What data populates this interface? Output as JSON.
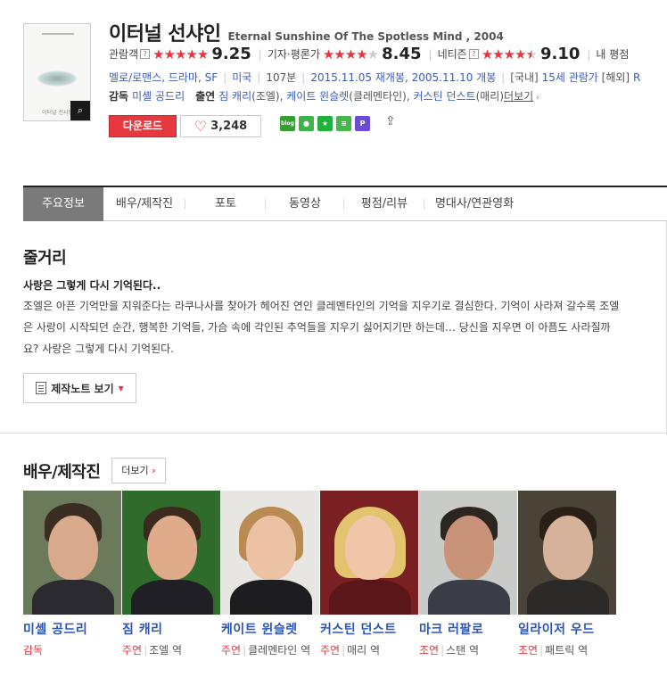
{
  "movie": {
    "title_ko": "이터널 선샤인",
    "title_en": "Eternal Sunshine Of The Spotless Mind , 2004",
    "poster_text": "이터널 선샤인"
  },
  "ratings": [
    {
      "label": "관람객",
      "score": "9.25",
      "stars_full": 5,
      "stars_half": false
    },
    {
      "label": "기자·평론가",
      "score": "8.45",
      "stars_full": 4,
      "stars_half": false
    },
    {
      "label": "네티즌",
      "score": "9.10",
      "stars_full": 4,
      "stars_half": true
    },
    {
      "label": "내 평점",
      "score": "",
      "stars_full": 0,
      "stars_half": false
    }
  ],
  "info": {
    "genres": "멜로/로맨스, 드라마, SF",
    "country": "미국",
    "runtime": "107분",
    "release_re": "2015.11.05 재개봉",
    "release_orig": "2005.11.10 개봉",
    "rating_kr_label": "[국내]",
    "rating_kr": "15세 관람가",
    "rating_os_label": "[해외]",
    "rating_os": "R"
  },
  "credits": {
    "director_label": "감독",
    "director": "미셸 공드리",
    "cast_label": "출연",
    "cast1": "짐 캐리",
    "cast1_role": "(조엘)",
    "cast2": "케이트 윈슬렛",
    "cast2_role": "(클레멘타인)",
    "cast3": "커스틴 던스트",
    "cast3_role": "(매리)",
    "more": "더보기"
  },
  "actions": {
    "download": "다운로드",
    "likes": "3,248"
  },
  "share_icons": [
    {
      "name": "blog-share-icon",
      "text": "blog",
      "color": "#33a031"
    },
    {
      "name": "talk-share-icon",
      "text": "●",
      "color": "#3fb24a"
    },
    {
      "name": "bookmark-share-icon",
      "text": "★",
      "color": "#1fb13a"
    },
    {
      "name": "memo-share-icon",
      "text": "≡",
      "color": "#45b649"
    },
    {
      "name": "post-share-icon",
      "text": "P",
      "color": "#6b4bd8"
    }
  ],
  "tabs": [
    "주요정보",
    "배우/제작진",
    "포토",
    "동영상",
    "평점/리뷰",
    "명대사/연관영화"
  ],
  "synopsis": {
    "section_title": "줄거리",
    "headline": "사랑은 그렇게 다시 기억된다..",
    "body": "조엘은 아픈 기억만을 지워준다는 라쿠나사를 찾아가 헤어진 연인 클레멘타인의 기억을 지우기로 결심한다. 기억이 사라져 갈수록 조엘은 사랑이 시작되던 순간, 행복한 기억들, 가슴 속에 각인된 추억들을 지우기 싫어지기만 하는데… 당신을 지우면 이 아픔도 사라질까요? 사랑은 그렇게 다시 기억된다.",
    "notes_button": "제작노트 보기"
  },
  "people": {
    "section_title": "배우/제작진",
    "more_button": "더보기",
    "list": [
      {
        "name": "미셸 공드리",
        "type": "감독",
        "role": ""
      },
      {
        "name": "짐 캐리",
        "type": "주연",
        "role": "조엘 역"
      },
      {
        "name": "케이트 윈슬렛",
        "type": "주연",
        "role": "클레멘타인 역"
      },
      {
        "name": "커스틴 던스트",
        "type": "주연",
        "role": "매리 역"
      },
      {
        "name": "마크 러팔로",
        "type": "조연",
        "role": "스탠 역"
      },
      {
        "name": "일라이저 우드",
        "type": "조연",
        "role": "패트릭 역"
      }
    ]
  }
}
